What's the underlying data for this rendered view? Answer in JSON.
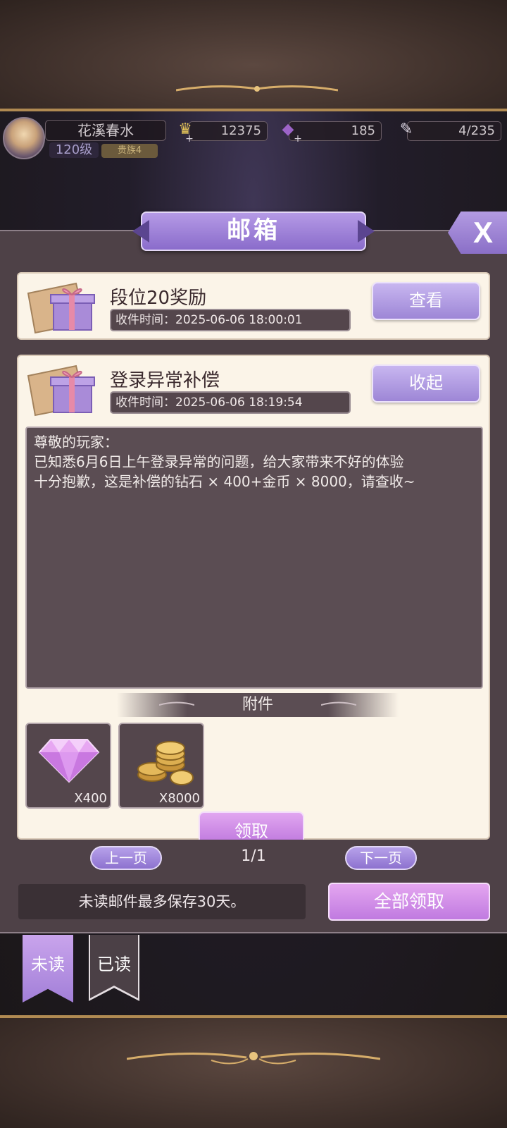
{
  "player": {
    "name": "花溪春水",
    "level": "120级",
    "rank": "贵族4"
  },
  "resources": {
    "coins": "12375",
    "gems": "185",
    "stamina": "4/235"
  },
  "dialog": {
    "title": "邮箱",
    "close_label": "X"
  },
  "mails": [
    {
      "title": "段位20奖励",
      "time": "收件时间：2025-06-06 18:00:01",
      "button": "查看"
    },
    {
      "title": "登录异常补偿",
      "time": "收件时间：2025-06-06 18:19:54",
      "button": "收起",
      "content": [
        "尊敬的玩家：",
        "已知悉6月6日上午登录异常的问题，给大家带来不好的体验",
        "十分抱歉，这是补偿的钻石 × 400+金币 × 8000，请查收~"
      ],
      "attachment_title": "附件",
      "attachments": [
        {
          "icon": "diamond-icon",
          "qty": "X400"
        },
        {
          "icon": "gold-coins-icon",
          "qty": "X8000"
        }
      ],
      "claim_label": "领取"
    }
  ],
  "pagination": {
    "prev": "上一页",
    "page": "1/1",
    "next": "下一页"
  },
  "notice": "未读邮件最多保存30天。",
  "claim_all": "全部领取",
  "tabs": {
    "unread": "未读",
    "read": "已读"
  },
  "colors": {
    "accent_purple": "#9d86d6",
    "claim_pink": "#c37ee0",
    "card_bg": "#fbf4e8",
    "panel_bg": "#4e4147"
  }
}
